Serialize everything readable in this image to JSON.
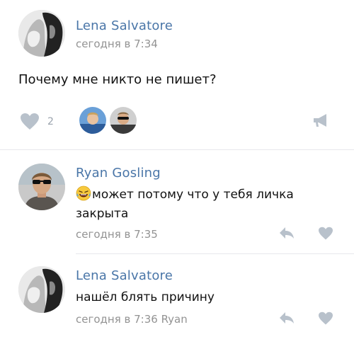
{
  "post": {
    "author": "Lena Salvatore",
    "time": "сегодня в 7:34",
    "text": "Почему мне никто не пишет?",
    "likes_count": "2"
  },
  "comments": [
    {
      "author": "Ryan Gosling",
      "text": "может потому что у тебя личка",
      "text_line2": "закрыта",
      "time": "сегодня в 7:35"
    },
    {
      "author": "Lena Salvatore",
      "text": "нашёл блять причину",
      "time": "сегодня в 7:36",
      "reply_to": "Ryan"
    }
  ],
  "icons": {
    "heart": "heart-icon",
    "share": "megaphone-icon",
    "reply": "reply-arrow-icon",
    "emoji": "laughing-crying-emoji-icon"
  },
  "colors": {
    "name_link": "#4a76a8",
    "meta_gray": "#939393",
    "icon_gray": "#b8c1cb"
  }
}
